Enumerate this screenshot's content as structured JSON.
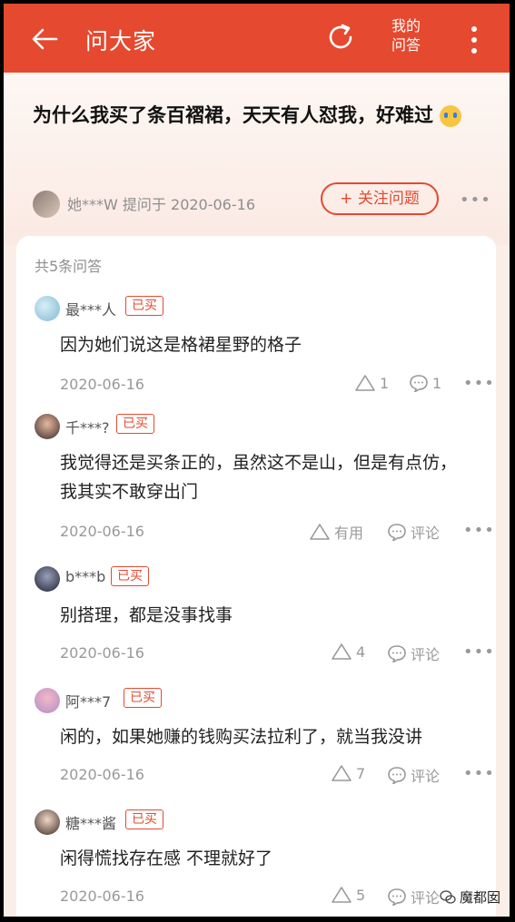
{
  "header": {
    "title": "问大家",
    "my_qa_line1": "我的",
    "my_qa_line2": "问答",
    "bg_color": "#e5492f"
  },
  "question": {
    "title": "为什么我买了条百褶裙，天天有人怼我，好难过",
    "asker": "她***W",
    "asked_label": "提问于 2020-06-16",
    "follow_label": "+ 关注问题"
  },
  "answers_count": "共5条问答",
  "answers": [
    {
      "user": "最***人",
      "badge": "已买",
      "text": "因为她们说这是格裙星野的格子",
      "date": "2020-06-16",
      "likes": "1",
      "comments": "1"
    },
    {
      "user": "千***?",
      "badge": "已买",
      "text": "我觉得还是买条正的，虽然这不是山，但是有点仿，我其实不敢穿出门",
      "date": "2020-06-16",
      "likes": "有用",
      "comments": "评论"
    },
    {
      "user": "b***b",
      "badge": "已买",
      "text": "别搭理，都是没事找事",
      "date": "2020-06-16",
      "likes": "4",
      "comments": "评论"
    },
    {
      "user": "阿***7",
      "badge": "已买",
      "text": "闲的，如果她赚的钱购买法拉利了，就当我没讲",
      "date": "2020-06-16",
      "likes": "7",
      "comments": "评论"
    },
    {
      "user": "糖***酱",
      "badge": "已买",
      "text": "闲得慌找存在感 不理就好了",
      "date": "2020-06-16",
      "likes": "5",
      "comments": "评论"
    }
  ],
  "watermark": "魔都囡",
  "icons": [
    "back-arrow-icon",
    "refresh-icon",
    "more-vert-icon",
    "like-triangle-icon",
    "comment-icon",
    "more-horiz-icon"
  ]
}
